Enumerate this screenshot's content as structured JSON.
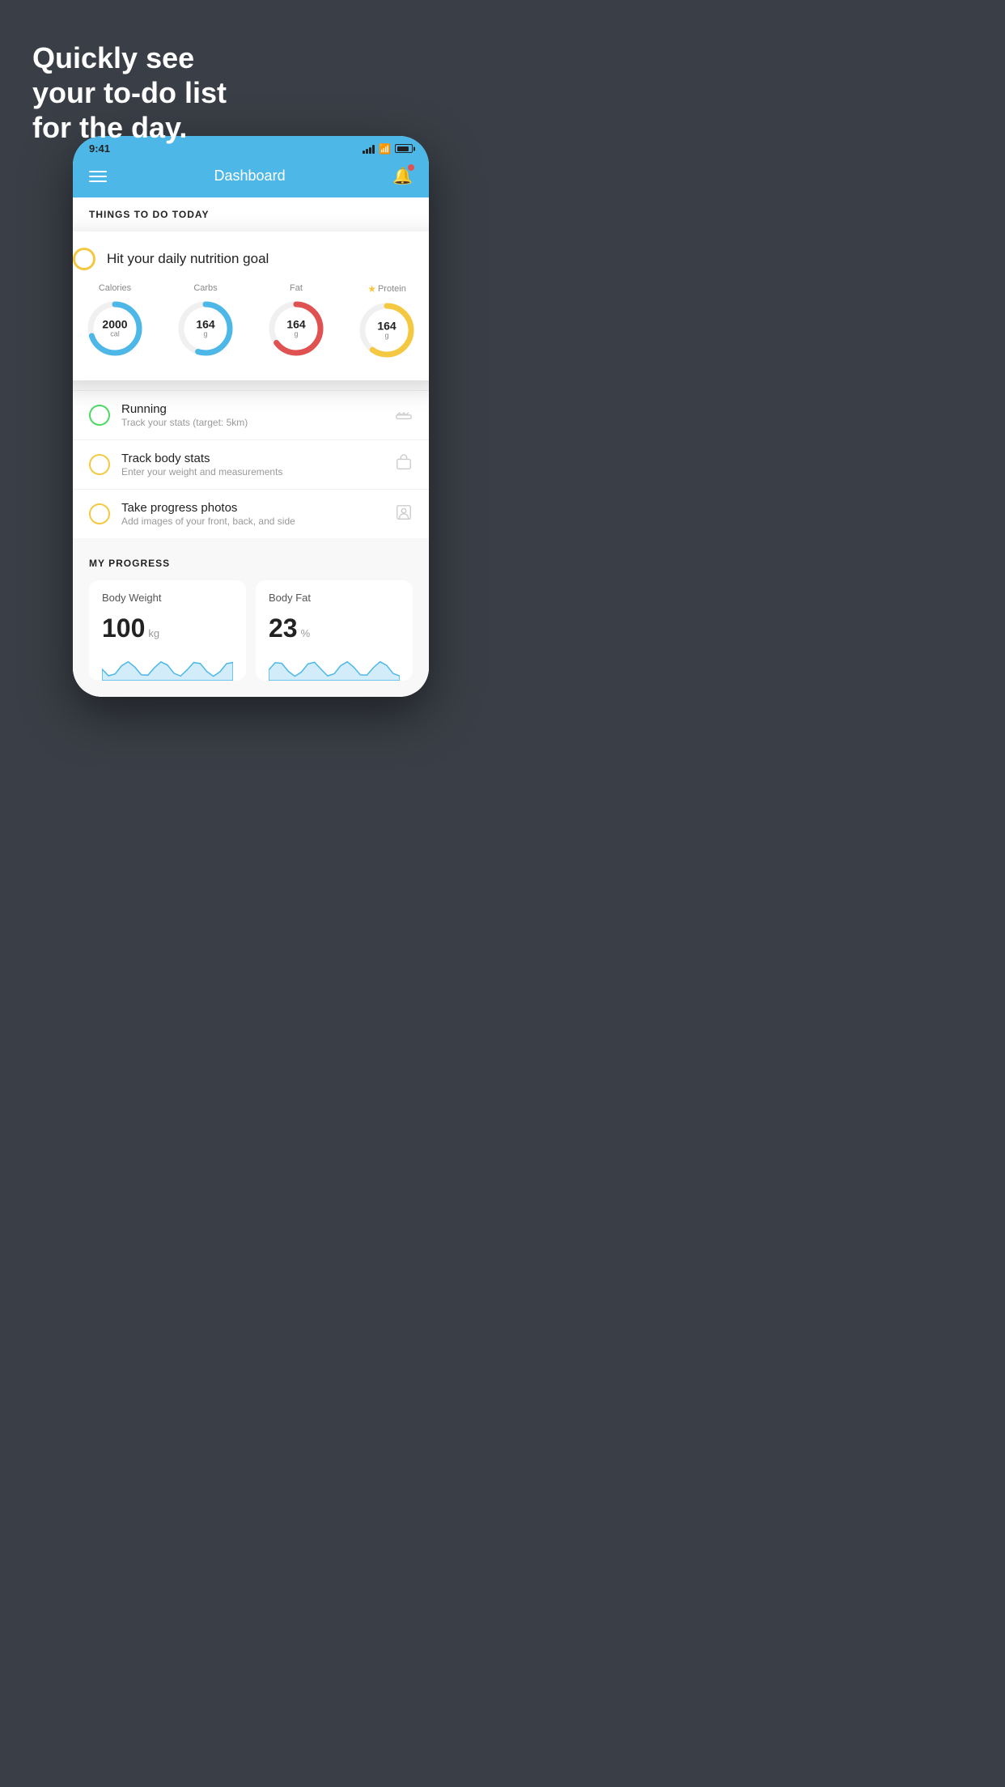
{
  "hero": {
    "line1": "Quickly see",
    "line2": "your to-do list",
    "line3": "for the day."
  },
  "status_bar": {
    "time": "9:41"
  },
  "header": {
    "title": "Dashboard"
  },
  "things_header": "THINGS TO DO TODAY",
  "nutrition_card": {
    "title": "Hit your daily nutrition goal",
    "metrics": [
      {
        "label": "Calories",
        "value": "2000",
        "unit": "cal",
        "color": "#4db8e8",
        "starred": false,
        "pct": 70
      },
      {
        "label": "Carbs",
        "value": "164",
        "unit": "g",
        "color": "#4db8e8",
        "starred": false,
        "pct": 55
      },
      {
        "label": "Fat",
        "value": "164",
        "unit": "g",
        "color": "#e05252",
        "starred": false,
        "pct": 65
      },
      {
        "label": "Protein",
        "value": "164",
        "unit": "g",
        "color": "#f5c842",
        "starred": true,
        "pct": 60
      }
    ]
  },
  "todo_items": [
    {
      "title": "Running",
      "subtitle": "Track your stats (target: 5km)",
      "circle_color": "green",
      "icon": "shoe"
    },
    {
      "title": "Track body stats",
      "subtitle": "Enter your weight and measurements",
      "circle_color": "yellow",
      "icon": "scale"
    },
    {
      "title": "Take progress photos",
      "subtitle": "Add images of your front, back, and side",
      "circle_color": "yellow",
      "icon": "person"
    }
  ],
  "progress": {
    "section_title": "MY PROGRESS",
    "cards": [
      {
        "title": "Body Weight",
        "value": "100",
        "unit": "kg"
      },
      {
        "title": "Body Fat",
        "value": "23",
        "unit": "%"
      }
    ]
  }
}
